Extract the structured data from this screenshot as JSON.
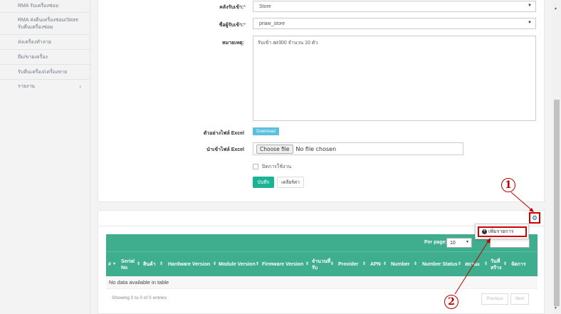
{
  "sidebar": {
    "items": [
      {
        "label": "RMA รับเครื่องซ่อม"
      },
      {
        "label": "RMA ส่งคืนเครื่องซ่อม/Store"
      },
      {
        "label": "รับคืนเครื่องซ่อม"
      },
      {
        "label": "ส่งเครื่องทำลาย"
      },
      {
        "label": "ยืม/ขายเครื่อง"
      },
      {
        "label": "รับคืนเครื่อง/เครื่องหาย"
      },
      {
        "label": "รายงาน",
        "arrow": "›"
      }
    ]
  },
  "form": {
    "warehouse": {
      "label": "คลังรับเข้า:",
      "required": "*",
      "value": "Store"
    },
    "receiver": {
      "label": "ชื่อผู้รับเข้า:",
      "required": "*",
      "value": "priaw_store"
    },
    "note": {
      "label": "หมายเหตุ:",
      "value": "รับเข้า air300 จำนวน 10 ตัว"
    },
    "sample_file": {
      "label": "ตัวอย่างไฟล์ Excel",
      "button": "Download"
    },
    "import_file": {
      "label": "นำเข้าไฟล์ Excel",
      "button": "Choose file",
      "status": "No file chosen"
    },
    "disable_checkbox": {
      "label": "ปิดการใช้งาน"
    },
    "save_button": "บันทึก",
    "clear_button": "เคลียร์ค่า"
  },
  "table_panel": {
    "gear_icon": "gear-icon",
    "dropdown_item": "เพิ่มรายการ",
    "per_page_label": "Per page:",
    "per_page_value": "10",
    "columns": [
      {
        "label": "#"
      },
      {
        "label": "Serial No"
      },
      {
        "label": "สินค้า"
      },
      {
        "label": "Hardware Version"
      },
      {
        "label": "Module Version"
      },
      {
        "label": "Firmware Version"
      },
      {
        "label": "จำนวนที่รับ"
      },
      {
        "label": "Provider"
      },
      {
        "label": "APN"
      },
      {
        "label": "Number"
      },
      {
        "label": "Number Status"
      },
      {
        "label": "สถานะ"
      },
      {
        "label": "วันที่สร้าง"
      },
      {
        "label": "จัดการ"
      }
    ],
    "empty_text": "No data available in table",
    "info_text": "Showing 0 to 0 of 0 entries",
    "prev_button": "Previous",
    "next_button": "Next"
  },
  "callouts": {
    "one": "1",
    "two": "2"
  },
  "colors": {
    "accent": "#3fae8e",
    "primary": "#1ab394",
    "info": "#5bc0de",
    "annotation": "#c00000"
  }
}
